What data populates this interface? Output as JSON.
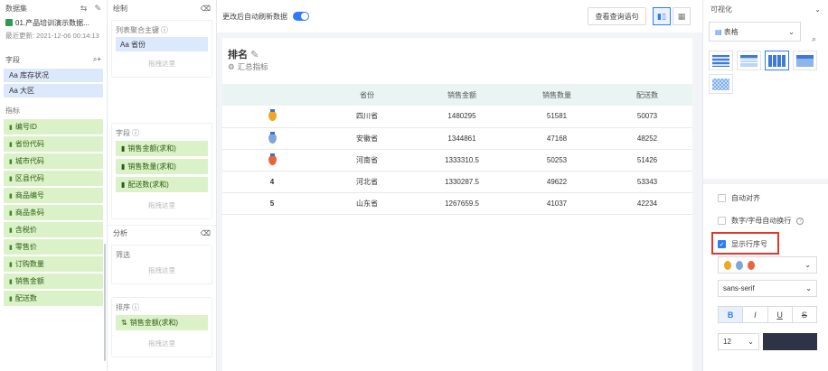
{
  "left": {
    "header": "数据集",
    "dataset_name": "01.产品培训演示数据...",
    "updated": "最近更新: 2021-12-06 00:14:13",
    "fields_label": "字段",
    "dimensions": [
      "库存状况",
      "大区"
    ],
    "measures_label": "指标",
    "measures": [
      "编号ID",
      "省份代码",
      "城市代码",
      "区县代码",
      "商品编号",
      "商品条码",
      "含税价",
      "零售价",
      "订购数量",
      "销售金额",
      "配送数"
    ]
  },
  "mid": {
    "header": "绘制",
    "pivot_title": "列表聚合主键",
    "pivot_chip": "省份",
    "drop_hint": "拖拽这里",
    "fields_title": "字段",
    "field_chips": [
      "销售金额(求和)",
      "销售数量(求和)",
      "配送数(求和)"
    ],
    "analysis_title": "分析",
    "filter_title": "筛选",
    "sort_title": "排序",
    "sort_chip": "销售金额(求和)"
  },
  "canvas": {
    "toggle_label": "更改后自动刷新数据",
    "view_sql": "查看查询语句",
    "card_title": "排名",
    "card_subtitle": "汇总指标",
    "columns": [
      "",
      "省份",
      "销售金额",
      "销售数量",
      "配送数"
    ],
    "rows": [
      {
        "rank": "1",
        "province": "四川省",
        "sales": "1480295",
        "qty": "51581",
        "delivery": "50073"
      },
      {
        "rank": "2",
        "province": "安徽省",
        "sales": "1344861",
        "qty": "47168",
        "delivery": "48252"
      },
      {
        "rank": "3",
        "province": "河南省",
        "sales": "1333310.5",
        "qty": "50253",
        "delivery": "51426"
      },
      {
        "rank": "4",
        "province": "河北省",
        "sales": "1330287.5",
        "qty": "49622",
        "delivery": "53343"
      },
      {
        "rank": "5",
        "province": "山东省",
        "sales": "1267659.5",
        "qty": "41037",
        "delivery": "42234"
      }
    ],
    "medal_colors": [
      "#f0a623",
      "#7fa6d8",
      "#e8643a"
    ]
  },
  "right": {
    "header": "可视化",
    "chart_type": "表格",
    "opt_auto_align": "自动对齐",
    "opt_wrap": "数字/字母自动换行",
    "opt_show_row_no": "显示行序号",
    "font": "sans-serif",
    "font_size": "12",
    "fmt_bold": "B",
    "fmt_italic": "I",
    "fmt_underline": "U",
    "fmt_strike": "S",
    "text_color": "#2e3445",
    "accent": "#2f7cf6",
    "highlight_color": "#e3372d"
  }
}
